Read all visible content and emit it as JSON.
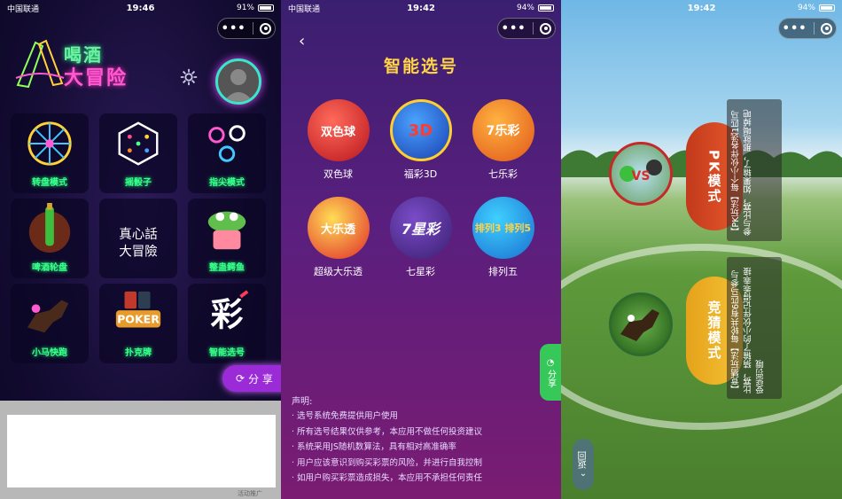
{
  "panel1": {
    "status": {
      "carrier": "中国联通",
      "time": "19:46",
      "battery": "91%"
    },
    "logo": {
      "line1": "喝酒",
      "line2": "大冒险"
    },
    "tiles": [
      {
        "label": "转盘模式",
        "icon": "wheel-icon"
      },
      {
        "label": "摇骰子",
        "icon": "dice-icon"
      },
      {
        "label": "指尖模式",
        "icon": "fingertip-icon"
      },
      {
        "label": "啤酒轮盘",
        "icon": "beer-roulette-icon"
      },
      {
        "label": "",
        "icon": "truth-dare-icon",
        "art_text": "真心話大冒險"
      },
      {
        "label": "整蛊鳄鱼",
        "icon": "crocodile-icon"
      },
      {
        "label": "小马快跑",
        "icon": "horse-race-icon"
      },
      {
        "label": "扑克牌",
        "icon": "poker-icon",
        "art_text": "POKER"
      },
      {
        "label": "智能选号",
        "icon": "lottery-icon",
        "art_text": "彩"
      }
    ],
    "share_label": "分 享",
    "bottom_tag": "活动推广"
  },
  "panel2": {
    "status": {
      "carrier": "中国联通",
      "time": "19:42",
      "battery": "94%"
    },
    "title": "智能选号",
    "lotteries": [
      {
        "label": "双色球",
        "icon": "union-lotto-icon",
        "art_text": "双色球"
      },
      {
        "label": "福彩3D",
        "icon": "fucai-3d-icon",
        "art_text": "3D"
      },
      {
        "label": "七乐彩",
        "icon": "qilecai-icon",
        "art_text": "7乐彩"
      },
      {
        "label": "超级大乐透",
        "icon": "super-lotto-icon",
        "art_text": "大乐透"
      },
      {
        "label": "七星彩",
        "icon": "seven-star-icon",
        "art_text": "7星彩"
      },
      {
        "label": "排列五",
        "icon": "pailie-five-icon",
        "art_text": "排列3 排列5"
      }
    ],
    "notice_title": "声明:",
    "notices": [
      "· 选号系统免费提供用户使用",
      "· 所有选号结果仅供参考，本应用不做任何投资建议",
      "· 系统采用JS随机数算法，具有相对高准确率",
      "· 用户应该意识到购买彩票的风险，并进行自我控制",
      "· 如用户购买彩票造成损失，本应用不承担任何责任"
    ],
    "share_label": "分享"
  },
  "panel3": {
    "status": {
      "time": "19:42",
      "battery": "94%"
    },
    "pk_label": "PK模式",
    "guess_label": "竞猜模式",
    "pk_rule": "【PK玩法】每个小伙伴各选1匹马参与比赛，如果输了，那就喝掉吧",
    "guess_rule": "【竞猜玩法】每轮共有6匹马参与比赛，猜输了的小伙伴记得乖乖接受惩罚哦",
    "back_label": "返回"
  },
  "colors": {
    "neon_green": "#39ff8f",
    "lottery_gold": "#ffd447",
    "pk_red": "#c23a1c",
    "guess_gold": "#e5a21b"
  }
}
